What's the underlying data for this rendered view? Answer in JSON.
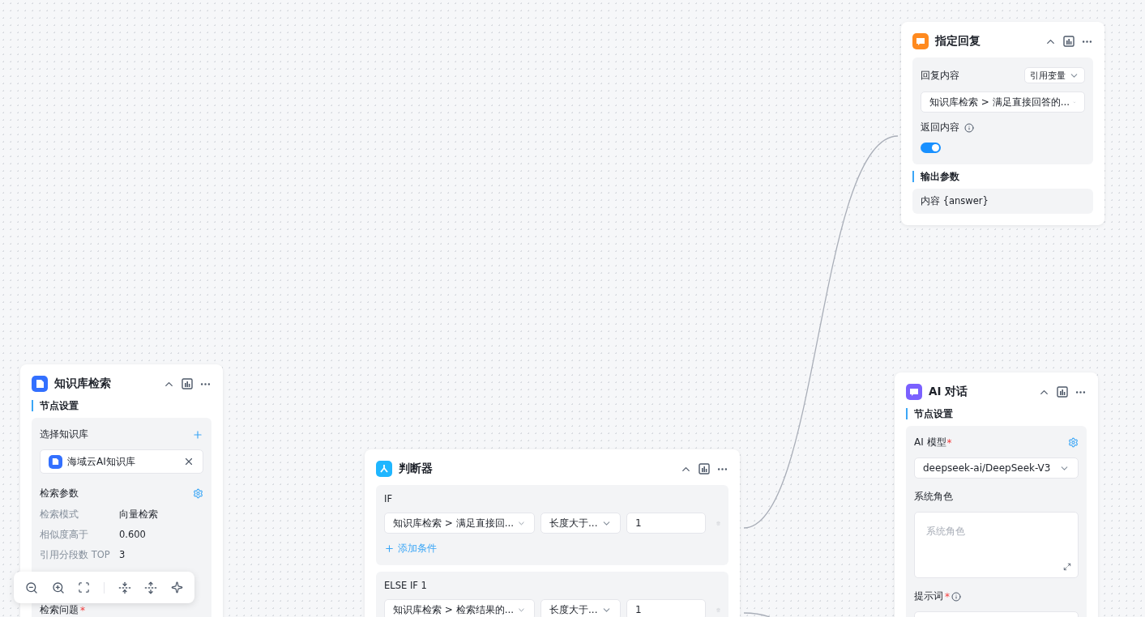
{
  "reply_node": {
    "title": "指定回复",
    "reply_label": "回复内容",
    "source_select": "引用变量",
    "reply_value": "知识库检索 > 满足直接回答的...",
    "return_label": "返回内容",
    "return_on": true,
    "output_section": "输出参数",
    "output_item": "内容 {answer}"
  },
  "kb_node": {
    "title": "知识库检索",
    "section": "节点设置",
    "select_label": "选择知识库",
    "selected_kb": "海域云AI知识库",
    "params_label": "检索参数",
    "params": [
      {
        "label": "检索模式",
        "value": "向量检索"
      },
      {
        "label": "相似度高于",
        "value": "0.600"
      },
      {
        "label": "引用分段数 TOP",
        "value": "3"
      }
    ],
    "question_label": "检索问题",
    "question_mark": "*"
  },
  "judge_node": {
    "title": "判断器",
    "branches": [
      {
        "label": "IF",
        "conditions": [
          {
            "variable": "知识库检索 > 满足直接回...",
            "operator": "长度大于...",
            "value": "1"
          }
        ],
        "add_label": "添加条件"
      },
      {
        "label": "ELSE IF 1",
        "conditions": [
          {
            "variable": "知识库检索 > 检索结果的...",
            "operator": "长度大于...",
            "value": "1"
          }
        ]
      }
    ]
  },
  "ai_node": {
    "title": "AI 对话",
    "section": "节点设置",
    "model_label": "AI 模型",
    "model_mark": "*",
    "model_value": "deepseek-ai/DeepSeek-V3",
    "role_label": "系统角色",
    "role_placeholder": "系统角色",
    "prompt_label": "提示词",
    "prompt_mark": "*"
  }
}
